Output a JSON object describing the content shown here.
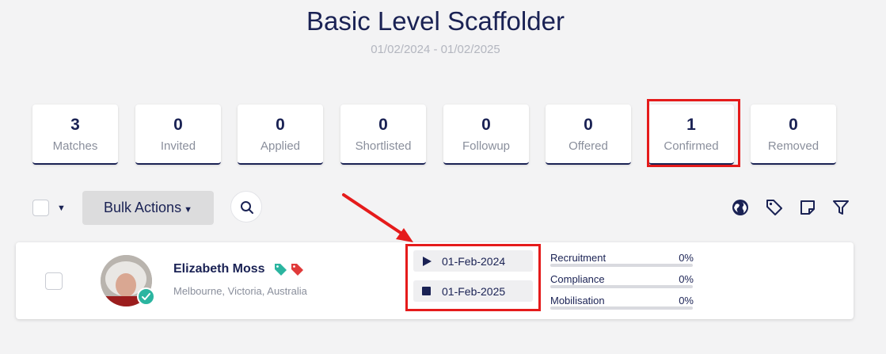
{
  "header": {
    "title": "Basic Level Scaffolder",
    "date_range": "01/02/2024 - 01/02/2025"
  },
  "stats": [
    {
      "count": "3",
      "label": "Matches"
    },
    {
      "count": "0",
      "label": "Invited"
    },
    {
      "count": "0",
      "label": "Applied"
    },
    {
      "count": "0",
      "label": "Shortlisted"
    },
    {
      "count": "0",
      "label": "Followup"
    },
    {
      "count": "0",
      "label": "Offered"
    },
    {
      "count": "1",
      "label": "Confirmed"
    },
    {
      "count": "0",
      "label": "Removed"
    }
  ],
  "toolbar": {
    "bulk_actions_label": "Bulk Actions",
    "icons": [
      "globe-icon",
      "tag-icon",
      "note-icon",
      "filter-icon"
    ]
  },
  "candidate": {
    "name": "Elizabeth Moss",
    "location": "Melbourne, Victoria, Australia",
    "tags": [
      {
        "icon": "tag-icon",
        "color": "#2bb5a0"
      },
      {
        "icon": "tag-icon",
        "color": "#e03a3a"
      }
    ],
    "start_date": "01-Feb-2024",
    "end_date": "01-Feb-2025",
    "progress": [
      {
        "label": "Recruitment",
        "percent": "0%",
        "value": 0
      },
      {
        "label": "Compliance",
        "percent": "0%",
        "value": 0
      },
      {
        "label": "Mobilisation",
        "percent": "0%",
        "value": 0
      }
    ]
  },
  "colors": {
    "primary": "#1a2254",
    "highlight": "#e51b1b",
    "verified": "#2bb5a0"
  }
}
